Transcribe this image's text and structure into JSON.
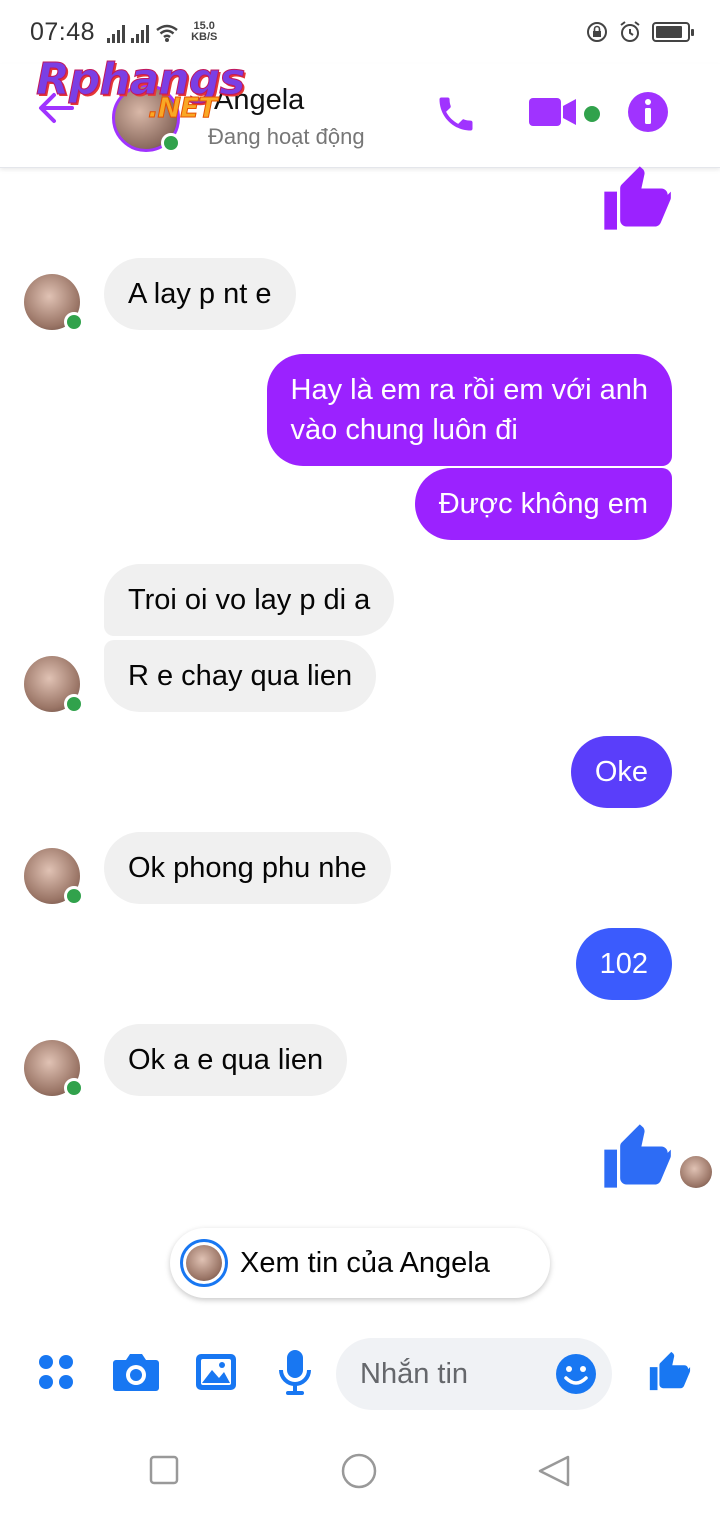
{
  "status_bar": {
    "time": "07:48",
    "net_speed_value": "15.0",
    "net_speed_unit": "KB/S"
  },
  "watermark": {
    "main": "Rphangs",
    "suffix": ".NET"
  },
  "header": {
    "contact_name": "Angela",
    "contact_status": "Đang hoạt động",
    "icons": [
      "back-arrow-icon",
      "phone-icon",
      "video-camera-icon",
      "info-icon"
    ],
    "accent_color": "#a033ff"
  },
  "messages": [
    {
      "sender": "contact",
      "text": "A lay p nt e"
    },
    {
      "sender": "me",
      "line1": "Hay là em ra rồi em với anh",
      "line2": "vào chung luôn đi"
    },
    {
      "sender": "me",
      "text": "Được không em"
    },
    {
      "sender": "contact",
      "text": "Troi oi vo lay p di a"
    },
    {
      "sender": "contact",
      "text": "R e chay qua lien"
    },
    {
      "sender": "me",
      "text": "Oke"
    },
    {
      "sender": "contact",
      "text": "Ok phong phu nhe"
    },
    {
      "sender": "me",
      "text": "102"
    },
    {
      "sender": "contact",
      "text": "Ok a e qua lien"
    }
  ],
  "story": {
    "label": "Xem tin của Angela"
  },
  "composer": {
    "placeholder": "Nhắn tin",
    "icons": [
      "apps-icon",
      "camera-icon",
      "image-icon",
      "microphone-icon",
      "emoji-icon",
      "thumbs-up-icon"
    ],
    "accent_color": "#1877f2"
  },
  "colors": {
    "outgoing_purple": "#9b22ff",
    "outgoing_blue": "#3b5bfd",
    "incoming_bg": "#f0f0f0",
    "online_green": "#31a24c"
  }
}
